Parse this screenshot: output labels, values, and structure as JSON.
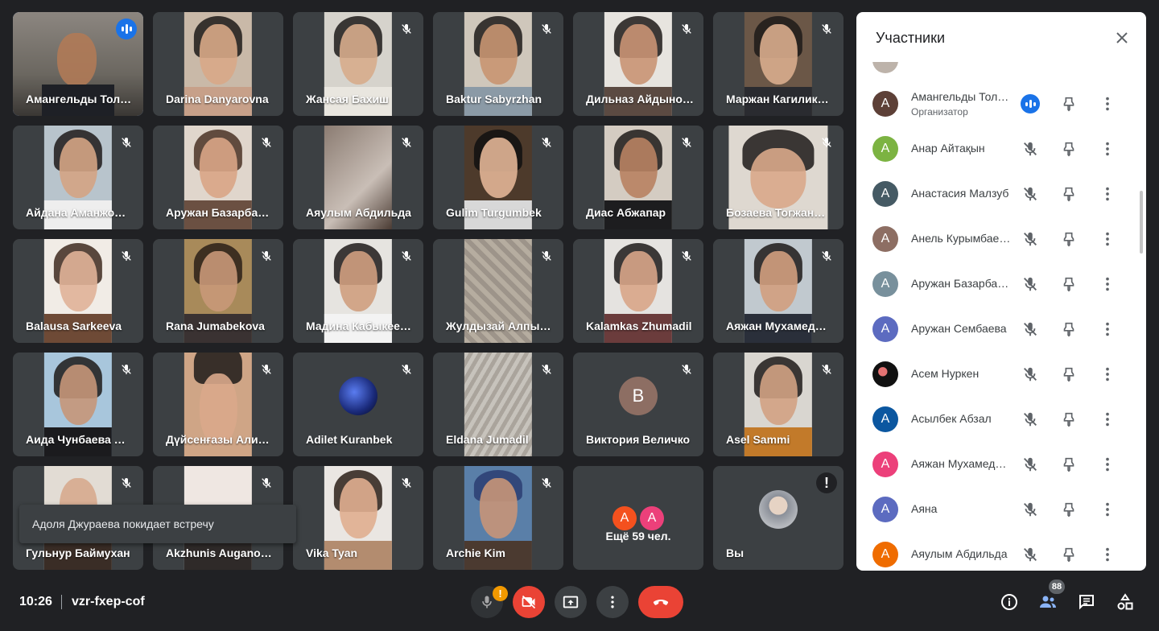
{
  "tiles": [
    {
      "name": "Амангельды Тол…"
    },
    {
      "name": "Darina Danyarovna"
    },
    {
      "name": "Жансая Бахиш"
    },
    {
      "name": "Baktur Sabyrzhan"
    },
    {
      "name": "Дильназ Айдыно…"
    },
    {
      "name": "Маржан Кагилик…"
    },
    {
      "name": "Айдана Аманжо…"
    },
    {
      "name": "Аружан Базарба…"
    },
    {
      "name": "Аяулым Абдильда"
    },
    {
      "name": "Gulim Turgumbek"
    },
    {
      "name": "Диас Абжапар"
    },
    {
      "name": "Бозаева Тогжан…"
    },
    {
      "name": "Balausa Sarkeeva"
    },
    {
      "name": "Rana Jumabekova"
    },
    {
      "name": "Мадина Кабыкее…"
    },
    {
      "name": "Жулдызай Алпы…"
    },
    {
      "name": "Kalamkas Zhumadil"
    },
    {
      "name": "Аяжан Мухамед…"
    },
    {
      "name": "Аида Чунбаева …"
    },
    {
      "name": "Дүйсенғазы Али…"
    },
    {
      "name": "Adilet Kuranbek"
    },
    {
      "name": "Eldana Jumadil"
    },
    {
      "name": "Виктория Величко",
      "avatar_letter": "В"
    },
    {
      "name": "Asel Sammi"
    },
    {
      "name": "Гульнур Баймухан"
    },
    {
      "name": "Akzhunis Augano…"
    },
    {
      "name": "Vika Tyan"
    },
    {
      "name": "Archie Kim"
    }
  ],
  "more_tile": {
    "label": "Ещё 59 чел.",
    "avatars": [
      "A",
      "A"
    ]
  },
  "self_tile": {
    "name": "Вы"
  },
  "toast": "Адоля Джураева покидает встречу",
  "panel": {
    "title": "Участники",
    "participants": [
      {
        "name": "Амангельды Тол…",
        "role": "Организатор",
        "letter": "A",
        "speaking": true
      },
      {
        "name": "Анар Айтақын",
        "letter": "A"
      },
      {
        "name": "Анастасия Малзуб",
        "letter": "A"
      },
      {
        "name": "Анель Курымбае…",
        "letter": "A"
      },
      {
        "name": "Аружан Базарба…",
        "letter": "A"
      },
      {
        "name": "Аружан Сембаева",
        "letter": "A"
      },
      {
        "name": "Асем Нуркен",
        "letter": ""
      },
      {
        "name": "Асылбек Абзал",
        "letter": "A"
      },
      {
        "name": "Аяжан Мухамед…",
        "letter": "A"
      },
      {
        "name": "Аяна",
        "letter": "A"
      },
      {
        "name": "Аяулым Абдильда",
        "letter": "A"
      }
    ]
  },
  "bottom": {
    "time": "10:26",
    "meeting_code": "vzr-fxep-cof",
    "mic_warning": "!",
    "people_count": "88"
  },
  "colors": {
    "accent": "#1a73e8",
    "danger": "#ea4335",
    "warning": "#f29900",
    "tile": "#3c4043",
    "bg": "#202124"
  }
}
